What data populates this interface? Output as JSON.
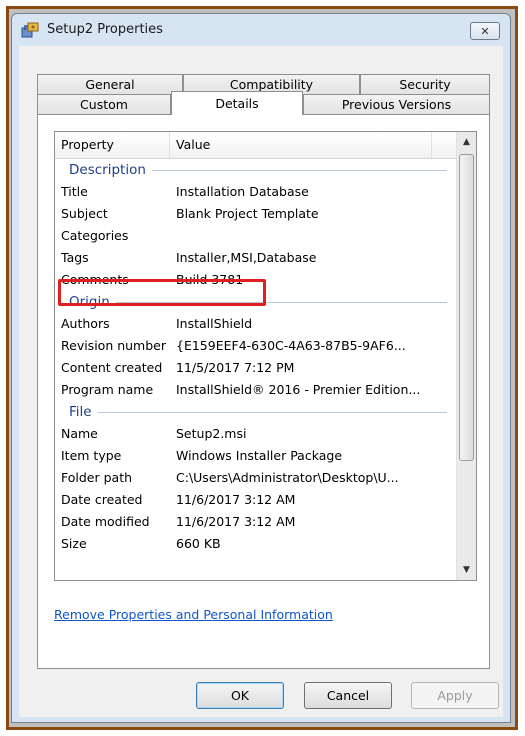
{
  "window": {
    "title": "Setup2 Properties",
    "close_glyph": "✕"
  },
  "tabs": {
    "back": [
      {
        "label": "General"
      },
      {
        "label": "Compatibility"
      },
      {
        "label": "Security"
      }
    ],
    "front": [
      {
        "label": "Custom"
      },
      {
        "label": "Details",
        "active": true
      },
      {
        "label": "Previous Versions"
      }
    ]
  },
  "list": {
    "headers": {
      "property": "Property",
      "value": "Value"
    },
    "groups": {
      "description": "Description",
      "origin": "Origin",
      "file": "File"
    },
    "rows": [
      {
        "property": "Title",
        "value": "Installation Database"
      },
      {
        "property": "Subject",
        "value": "Blank Project Template"
      },
      {
        "property": "Categories",
        "value": ""
      },
      {
        "property": "Tags",
        "value": "Installer,MSI,Database"
      },
      {
        "property": "Comments",
        "value": "Build 3781"
      },
      {
        "property": "Authors",
        "value": "InstallShield"
      },
      {
        "property": "Revision number",
        "value": "{E159EEF4-630C-4A63-87B5-9AF6..."
      },
      {
        "property": "Content created",
        "value": "11/5/2017 7:12 PM"
      },
      {
        "property": "Program name",
        "value": "InstallShield® 2016 - Premier Edition..."
      },
      {
        "property": "Name",
        "value": "Setup2.msi"
      },
      {
        "property": "Item type",
        "value": "Windows Installer Package"
      },
      {
        "property": "Folder path",
        "value": "C:\\Users\\Administrator\\Desktop\\U..."
      },
      {
        "property": "Date created",
        "value": "11/6/2017 3:12 AM"
      },
      {
        "property": "Date modified",
        "value": "11/6/2017 3:12 AM"
      },
      {
        "property": "Size",
        "value": "660 KB"
      }
    ]
  },
  "link": {
    "label": "Remove Properties and Personal Information"
  },
  "buttons": {
    "ok": "OK",
    "cancel": "Cancel",
    "apply": "Apply"
  },
  "colors": {
    "highlight": "#e02020",
    "frame": "#8a4a12",
    "link": "#1155cc",
    "group": "#1e3f8a"
  }
}
